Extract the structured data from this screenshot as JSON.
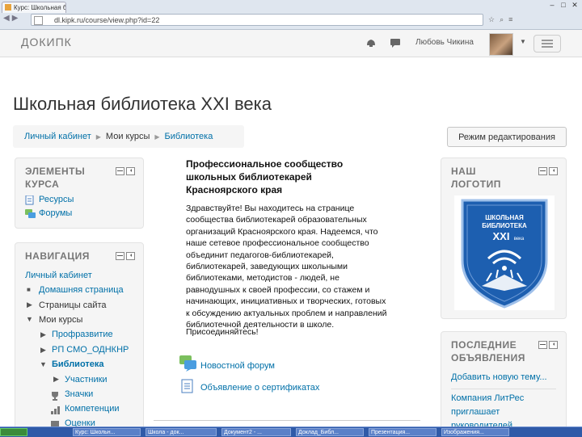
{
  "browser": {
    "tab_title": "Курс: Школьная библ...",
    "url": "dl.kipk.ru/course/view.php?id=22",
    "window_buttons": [
      "–",
      "□",
      "✕"
    ]
  },
  "navbar": {
    "brand": "ДОКИПК",
    "user_name": "Любовь Чикина"
  },
  "page": {
    "title": "Школьная библиотека XXI века",
    "breadcrumb": [
      "Личный кабинет",
      "Мои курсы",
      "Библиотека"
    ],
    "edit_button": "Режим редактирования"
  },
  "blocks": {
    "elements": {
      "title_line1": "ЭЛЕМЕНТЫ",
      "title_line2": "КУРСА",
      "items": [
        "Ресурсы",
        "Форумы"
      ]
    },
    "navigation": {
      "title": "НАВИГАЦИЯ",
      "items": [
        "Личный кабинет",
        "Домашняя страница",
        "Страницы сайта",
        "Мои курсы",
        "Профразвитие",
        "РП СМО_ОДНКНР",
        "Библиотека",
        "Участники",
        "Значки",
        "Компетенции",
        "Оценки"
      ]
    },
    "logo": {
      "title_line1": "НАШ",
      "title_line2": "ЛОГОТИП",
      "badge_text1": "ШКОЛЬНАЯ",
      "badge_text2": "БИБЛИОТЕКА",
      "badge_text3": "XXI",
      "badge_text4": "века"
    },
    "news": {
      "title_line1": "ПОСЛЕДНИЕ",
      "title_line2": "ОБЪЯВЛЕНИЯ",
      "add_topic": "Добавить новую тему...",
      "item_line1": "Компания ЛитРес",
      "item_line2": "приглашает",
      "item_line3": "руководителей"
    }
  },
  "content": {
    "title_lines": [
      "Профессиональное сообщество",
      "школьных библиотекарей",
      "Красноярского края"
    ],
    "body_lines": [
      "Здравствуйте! Вы находитесь на странице",
      "сообщества библиотекарей образовательных",
      "организаций Красноярского края. Надеемся, что",
      "наше сетевое профессиональное сообщество",
      "объединит педагогов-библиотекарей,",
      "библиотекарей, заведующих школьными",
      "библиотеками, методистов - людей, не",
      "равнодушных к своей профессии, со стажем и",
      "начинающих, инициативных и творческих, готовых",
      "к обсуждению актуальных проблем и направлений",
      "библиотечной деятельности в школе."
    ],
    "join": "Присоединяйтесь!",
    "forum_link": "Новостной форум",
    "cert_link": "Объявление о сертификатах"
  },
  "taskbar": {
    "items": [
      "",
      "Курс: Школьн...",
      "Школа - док...",
      "Документ2 - ...",
      "Доклад_Библ...",
      "Презентация...",
      "Изображения..."
    ]
  }
}
